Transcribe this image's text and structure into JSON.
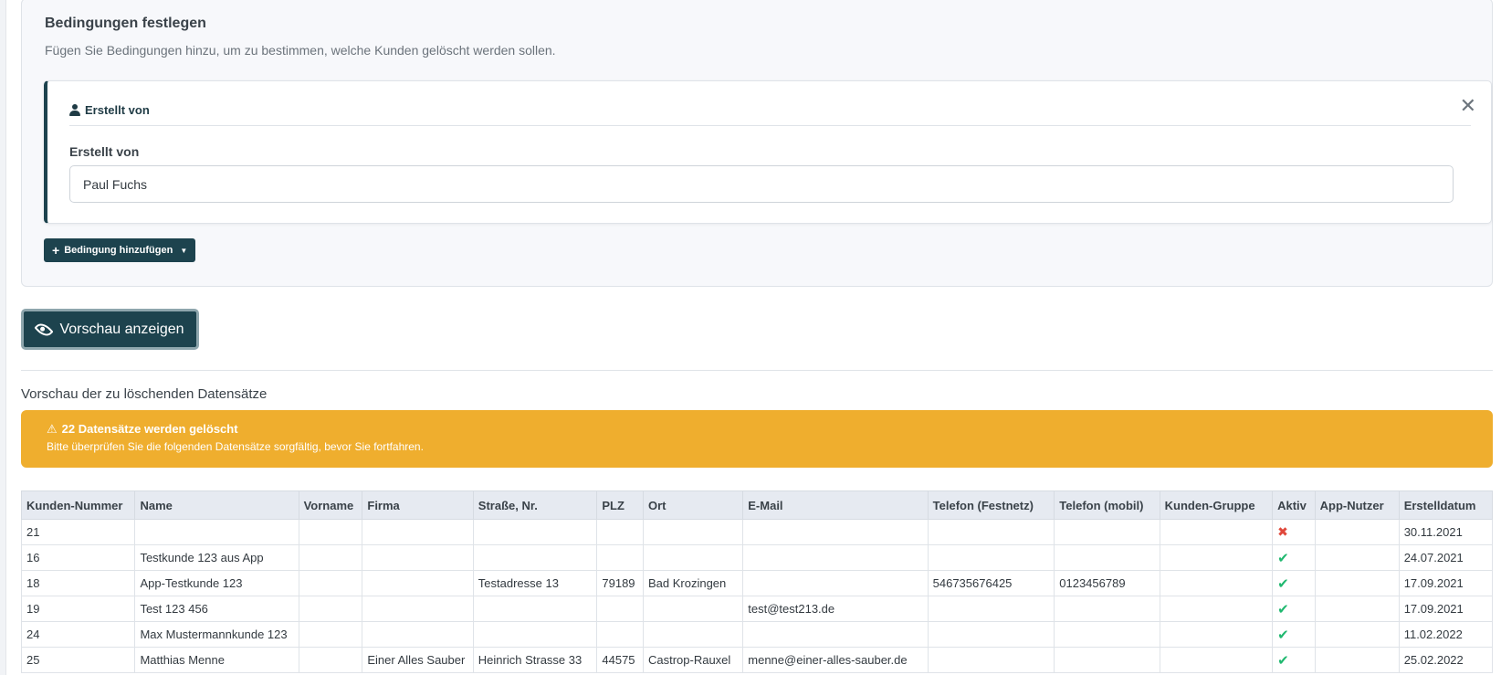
{
  "conditions": {
    "title": "Bedingungen festlegen",
    "subtitle": "Fügen Sie Bedingungen hinzu, um zu bestimmen, welche Kunden gelöscht werden sollen.",
    "condition": {
      "header": "Erstellt von",
      "header_icon": "user-icon",
      "close_symbol": "✕",
      "field_label": "Erstellt von",
      "field_value": "Paul Fuchs"
    },
    "add_button_label": "Bedingung hinzufügen"
  },
  "preview_button_label": "Vorschau anzeigen",
  "preview_title": "Vorschau der zu löschenden Datensätze",
  "alert": {
    "title": "22 Datensätze werden gelöscht",
    "text": "Bitte überprüfen Sie die folgenden Datensätze sorgfältig, bevor Sie fortfahren.",
    "color": "#efae2e"
  },
  "colors": {
    "primary": "#1d434e",
    "active_yes": "#1fb86f",
    "active_no": "#e0483b"
  },
  "table": {
    "columns": [
      "Kunden-Nummer",
      "Name",
      "Vorname",
      "Firma",
      "Straße, Nr.",
      "PLZ",
      "Ort",
      "E-Mail",
      "Telefon (Festnetz)",
      "Telefon (mobil)",
      "Kunden-Gruppe",
      "Aktiv",
      "App-Nutzer",
      "Erstelldatum"
    ],
    "rows": [
      {
        "nr": "21",
        "name": "",
        "vorname": "",
        "firma": "",
        "strasse": "",
        "plz": "",
        "ort": "",
        "email": "",
        "tel": "",
        "mobil": "",
        "gruppe": "",
        "aktiv": false,
        "app": "",
        "datum": "30.11.2021"
      },
      {
        "nr": "16",
        "name": "Testkunde 123 aus App",
        "vorname": "",
        "firma": "",
        "strasse": "",
        "plz": "",
        "ort": "",
        "email": "",
        "tel": "",
        "mobil": "",
        "gruppe": "",
        "aktiv": true,
        "app": "",
        "datum": "24.07.2021"
      },
      {
        "nr": "18",
        "name": "App-Testkunde 123",
        "vorname": "",
        "firma": "",
        "strasse": "Testadresse 13",
        "plz": "79189",
        "ort": "Bad Krozingen",
        "email": "",
        "tel": "546735676425",
        "mobil": "0123456789",
        "gruppe": "",
        "aktiv": true,
        "app": "",
        "datum": "17.09.2021"
      },
      {
        "nr": "19",
        "name": "Test 123 456",
        "vorname": "",
        "firma": "",
        "strasse": "",
        "plz": "",
        "ort": "",
        "email": "test@test213.de",
        "tel": "",
        "mobil": "",
        "gruppe": "",
        "aktiv": true,
        "app": "",
        "datum": "17.09.2021"
      },
      {
        "nr": "24",
        "name": "Max Mustermannkunde 123",
        "vorname": "",
        "firma": "",
        "strasse": "",
        "plz": "",
        "ort": "",
        "email": "",
        "tel": "",
        "mobil": "",
        "gruppe": "",
        "aktiv": true,
        "app": "",
        "datum": "11.02.2022"
      },
      {
        "nr": "25",
        "name": "Matthias Menne",
        "vorname": "",
        "firma": "Einer Alles Sauber",
        "strasse": "Heinrich Strasse 33",
        "plz": "44575",
        "ort": "Castrop-Rauxel",
        "email": "menne@einer-alles-sauber.de",
        "tel": "",
        "mobil": "",
        "gruppe": "",
        "aktiv": true,
        "app": "",
        "datum": "25.02.2022"
      }
    ]
  }
}
